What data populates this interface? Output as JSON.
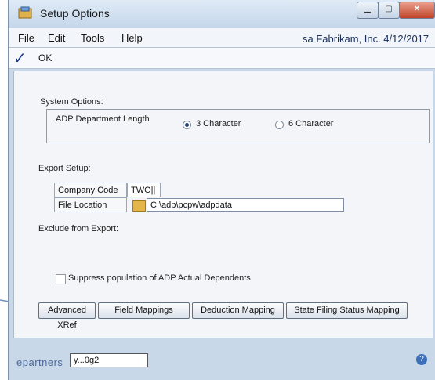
{
  "window": {
    "title": "Setup Options"
  },
  "menu": {
    "items": [
      "File",
      "Edit",
      "Tools",
      "Help"
    ]
  },
  "status": {
    "user_info": "sa  Fabrikam, Inc.  4/12/2017"
  },
  "toolbar": {
    "ok_label": "OK"
  },
  "system_options": {
    "heading": "System Options:",
    "dept_length_label": "ADP Department Length",
    "radio_3": "3 Character",
    "radio_6": "6 Character",
    "selected": "3 Character"
  },
  "export_setup": {
    "heading": "Export Setup:",
    "company_code_label": "Company Code",
    "company_code_value": "TWO||",
    "file_location_label": "File Location",
    "file_location_value": "C:\\adp\\pcpw\\adpdata"
  },
  "exclude": {
    "heading": "Exclude from Export:"
  },
  "suppress": {
    "label": "Suppress population of ADP Actual Dependents"
  },
  "buttons": {
    "advanced_xref": "Advanced XRef",
    "field_mappings": "Field Mappings",
    "deduction_mapping": "Deduction Mapping",
    "state_filing": "State Filing Status Mapping"
  },
  "footer": {
    "brand": "epartners",
    "user": "y...0g2"
  },
  "colors": {
    "callout_lines": "#6d8fbf",
    "window_frame": "#c9d8e8"
  }
}
